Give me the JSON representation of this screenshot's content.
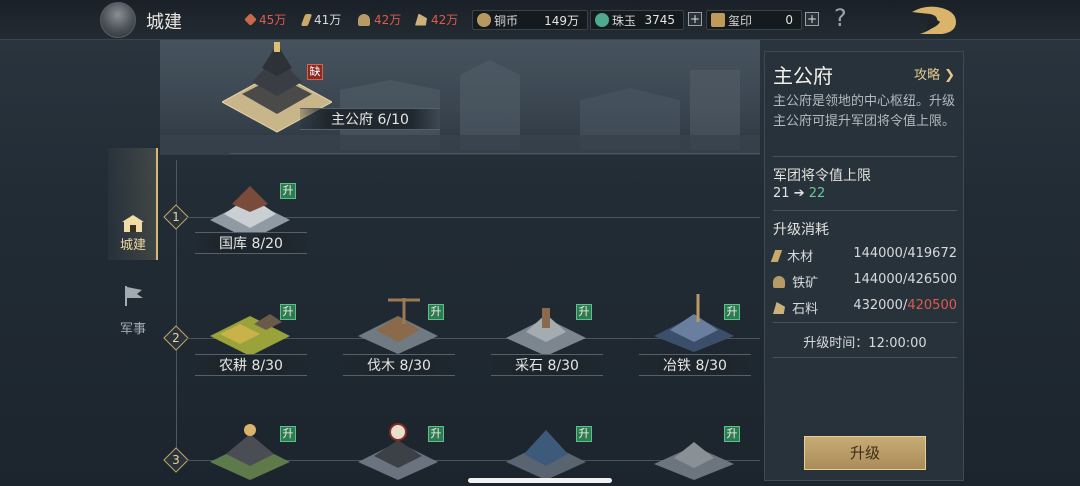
{
  "header": {
    "title": "城建",
    "resources": [
      {
        "icon": "food-icon",
        "value": "45万",
        "color": "#e05a4c"
      },
      {
        "icon": "wood-icon",
        "value": "41万",
        "color": "#d7dadc"
      },
      {
        "icon": "iron-icon",
        "value": "42万",
        "color": "#e05a4c"
      },
      {
        "icon": "stone-icon",
        "value": "42万",
        "color": "#e05a4c"
      }
    ],
    "currencies": [
      {
        "icon": "copper-coin-icon",
        "label": "铜币",
        "value": "149万"
      },
      {
        "icon": "jade-icon",
        "label": "珠玉",
        "value": "3745"
      },
      {
        "icon": "seal-icon",
        "label": "玺印",
        "value": "0"
      }
    ],
    "plus": "+",
    "help": "?"
  },
  "tabs": [
    {
      "label": "城建",
      "icon": "city-build-icon",
      "active": true
    },
    {
      "label": "军事",
      "icon": "military-flag-icon",
      "active": false
    }
  ],
  "main_building": {
    "name": "主公府 6/10",
    "badge": "缺"
  },
  "tiers": [
    {
      "num": "1",
      "buildings": [
        {
          "name": "国库 8/20",
          "badge": "升"
        }
      ]
    },
    {
      "num": "2",
      "buildings": [
        {
          "name": "农耕 8/30",
          "badge": "升"
        },
        {
          "name": "伐木 8/30",
          "badge": "升"
        },
        {
          "name": "采石 8/30",
          "badge": "升"
        },
        {
          "name": "冶铁 8/30",
          "badge": "升"
        }
      ]
    },
    {
      "num": "3",
      "buildings": [
        {
          "name": "",
          "badge": "升"
        },
        {
          "name": "",
          "badge": "升"
        },
        {
          "name": "",
          "badge": "升"
        },
        {
          "name": "",
          "badge": "升"
        }
      ]
    }
  ],
  "panel": {
    "title": "主公府",
    "guide": "攻略",
    "description": "主公府是领地的中心枢纽。升级主公府可提升军团将令值上限。",
    "stat_label": "军团将令值上限",
    "stat_current": "21",
    "stat_arrow": "➔",
    "stat_next": "22",
    "cost_label": "升级消耗",
    "costs": [
      {
        "icon": "wood-icon",
        "name": "木材",
        "have": "144000",
        "need": "419672",
        "short": false
      },
      {
        "icon": "iron-icon",
        "name": "铁矿",
        "have": "144000",
        "need": "426500",
        "short": false
      },
      {
        "icon": "stone-icon",
        "name": "石料",
        "have": "432000",
        "need": "420500",
        "short": true
      }
    ],
    "time": "升级时间：12:00:00",
    "button": "升级"
  }
}
